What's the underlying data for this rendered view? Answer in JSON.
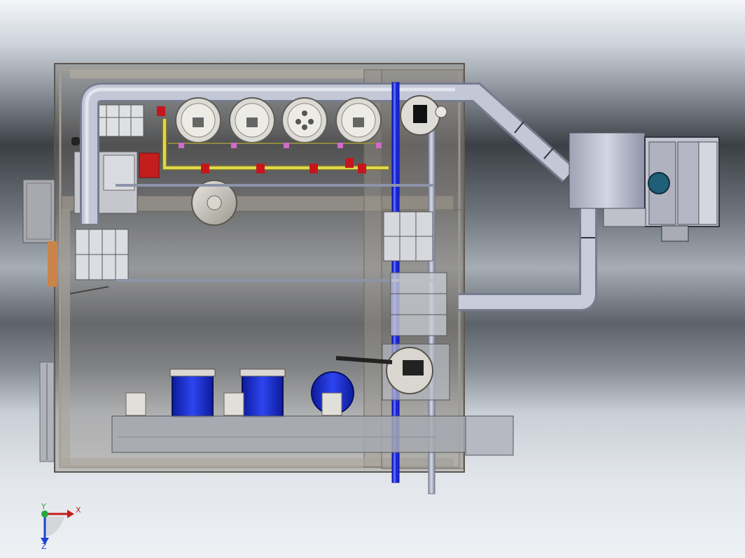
{
  "triad": {
    "x_label": "X",
    "y_label": "Y",
    "z_label": "Z"
  },
  "colors": {
    "frame": "#8c877f",
    "pipe": "#aab0c6",
    "blue_pipe": "#1a26d8",
    "drum_blue": "#1f33d6",
    "red_valve": "#c4161c",
    "yellow_pipe": "#e2d84a",
    "panel": "#b8bcc8",
    "accent_teal": "#1f5f78"
  },
  "icons": {
    "view_triad": "xyz-triad-icon"
  }
}
